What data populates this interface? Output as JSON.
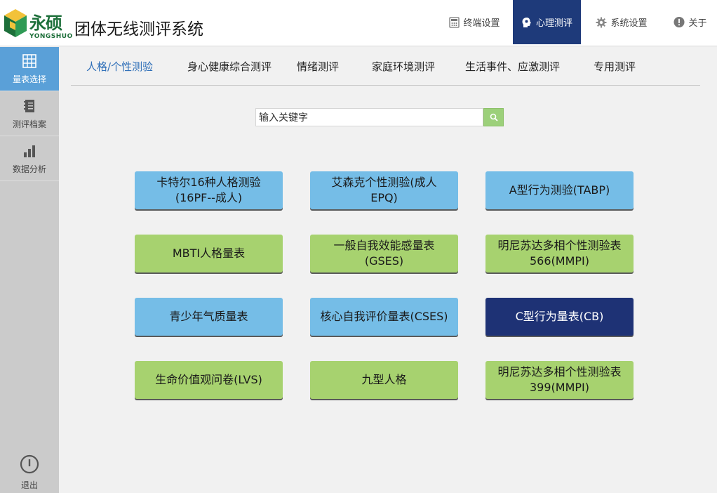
{
  "header": {
    "logo_text": "永硕",
    "logo_sub": "YONGSHUO",
    "app_title": "团体无线测评系统",
    "nav": [
      {
        "label": "终端设置",
        "icon": "calculator-icon",
        "active": false
      },
      {
        "label": "心理测评",
        "icon": "head-brain-icon",
        "active": true
      },
      {
        "label": "系统设置",
        "icon": "gear-icon",
        "active": false
      },
      {
        "label": "关于",
        "icon": "info-icon",
        "active": false
      }
    ]
  },
  "sidebar": {
    "items": [
      {
        "label": "量表选择",
        "icon": "grid-icon",
        "active": true
      },
      {
        "label": "测评档案",
        "icon": "notebook-icon",
        "active": false
      },
      {
        "label": "数据分析",
        "icon": "bar-chart-icon",
        "active": false
      }
    ],
    "logout_label": "退出"
  },
  "tabs": [
    {
      "label": "人格/个性测验",
      "active": true
    },
    {
      "label": "身心健康综合测评",
      "active": false
    },
    {
      "label": "情绪测评",
      "active": false
    },
    {
      "label": "家庭环境测评",
      "active": false
    },
    {
      "label": "生活事件、应激测评",
      "active": false
    },
    {
      "label": "专用测评",
      "active": false
    }
  ],
  "search": {
    "value": "输入关键字",
    "button_icon": "search-icon"
  },
  "tests": [
    {
      "label": "卡特尔16种人格测验\n(16PF--成人)",
      "color": "blue"
    },
    {
      "label": "艾森克个性测验(成人\nEPQ)",
      "color": "blue"
    },
    {
      "label": "A型行为测验(TABP)",
      "color": "blue"
    },
    {
      "label": "MBTI人格量表",
      "color": "green"
    },
    {
      "label": "一般自我效能感量表\n(GSES)",
      "color": "green"
    },
    {
      "label": "明尼苏达多相个性测验表\n566(MMPI)",
      "color": "green"
    },
    {
      "label": "青少年气质量表",
      "color": "blue"
    },
    {
      "label": "核心自我评价量表(CSES)",
      "color": "blue"
    },
    {
      "label": "C型行为量表(CB)",
      "color": "navy"
    },
    {
      "label": "生命价值观问卷(LVS)",
      "color": "green"
    },
    {
      "label": "九型人格",
      "color": "green"
    },
    {
      "label": "明尼苏达多相个性测验表\n399(MMPI)",
      "color": "green"
    }
  ],
  "colors": {
    "accent_navy": "#1e3a7a",
    "sidebar_active": "#5aa0d8",
    "tile_blue": "#75bde7",
    "tile_green": "#a7d26f",
    "tile_navy": "#1e3275",
    "tab_active": "#2f6fb8"
  }
}
